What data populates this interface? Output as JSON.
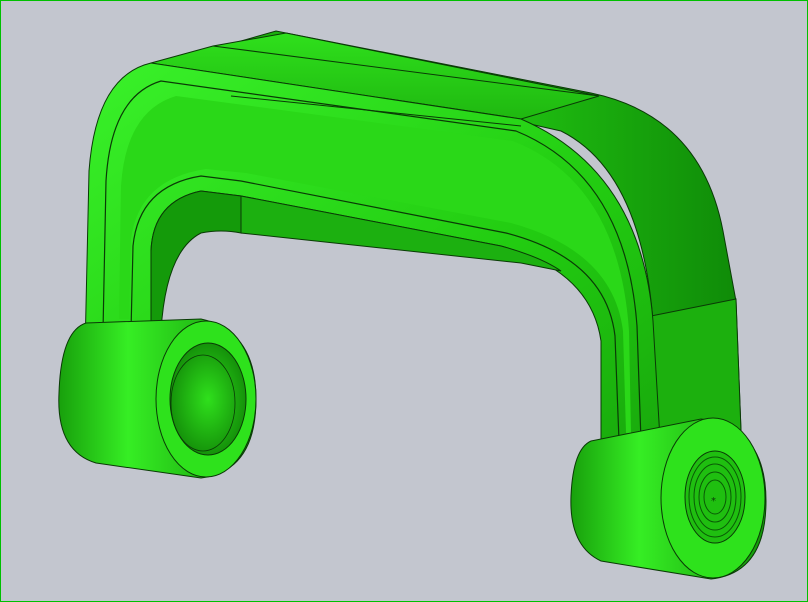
{
  "viewport": {
    "background_color": "#c3c6cf",
    "frame_color": "#00c000"
  },
  "model": {
    "part_color": "#22cc11",
    "highlight_color": "#3af22a",
    "shadow_color": "#0f8a08",
    "edge_color": "#0a3a06"
  }
}
